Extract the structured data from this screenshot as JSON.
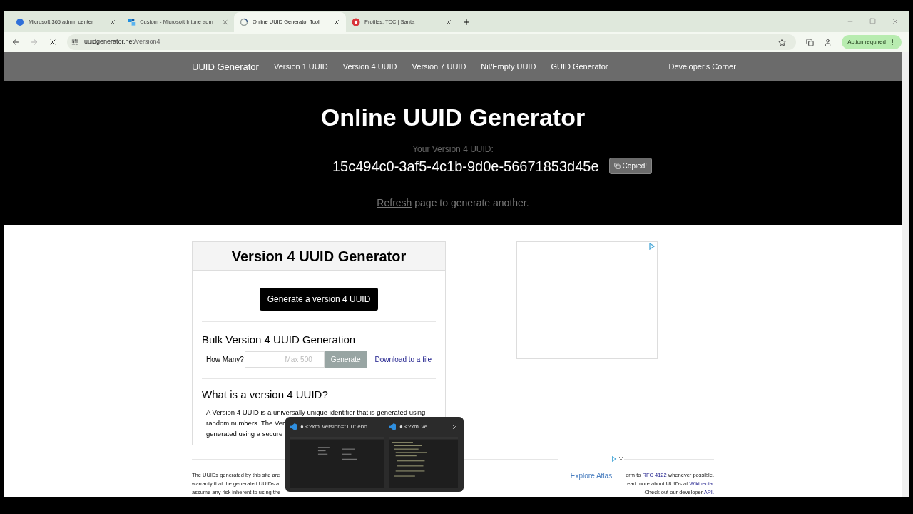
{
  "browser": {
    "tabs": [
      {
        "title": "Microsoft 365 admin center",
        "selected": false
      },
      {
        "title": "Custom - Microsoft Intune adm",
        "selected": false
      },
      {
        "title": "Online UUID Generator Tool",
        "selected": true
      },
      {
        "title": "Profiles: TCC | Santa",
        "selected": false
      }
    ],
    "url_host": "uuidgenerator.net",
    "url_path": "/version4",
    "action_button": "Action required"
  },
  "nav": {
    "brand": "UUID Generator",
    "links": [
      "Version 1 UUID",
      "Version 4 UUID",
      "Version 7 UUID",
      "Nil/Empty UUID",
      "GUID Generator"
    ],
    "right_link": "Developer's Corner"
  },
  "hero": {
    "title": "Online UUID Generator",
    "label": "Your Version 4 UUID:",
    "uuid": "15c494c0-3af5-4c1b-9d0e-56671853d45e",
    "copy_button": "Copied!",
    "refresh_link": "Refresh",
    "refresh_text": "page to generate another."
  },
  "card": {
    "title": "Version 4 UUID Generator",
    "generate_button": "Generate a version 4 UUID",
    "bulk_title": "Bulk Version 4 UUID Generation",
    "how_many_label": "How Many?",
    "how_many_placeholder": "Max 500",
    "bulk_button": "Generate",
    "download_link": "Download to a file",
    "about_title": "What is a version 4 UUID?",
    "about_lines": [
      "A Version 4 UUID is a universally unique identifier that is generated using",
      "random numbers. The Ver",
      "generated using a secure"
    ]
  },
  "footer": {
    "left_lines": [
      "The UUIDs generated by this site are",
      "warranty that the generated UUIDs a",
      "assume any risk inherent to using the"
    ],
    "right_lines": [
      [
        {
          "text": "orm to ",
          "kind": "text"
        },
        {
          "text": "RFC 4122",
          "kind": "link"
        },
        {
          "text": " whenever possible.",
          "kind": "text"
        }
      ],
      [
        {
          "text": "ead more about UUIDs at ",
          "kind": "text"
        },
        {
          "text": "Wikipedia.",
          "kind": "link"
        }
      ],
      [
        {
          "text": "Check out our developer ",
          "kind": "text"
        },
        {
          "text": "API.",
          "kind": "link"
        }
      ]
    ]
  },
  "ad_overlay": {
    "label": "Explore Atlas"
  },
  "preview_popup": {
    "windows": [
      "● <?xml version=\"1.0\" enc...",
      "● <?xml ve..."
    ]
  }
}
